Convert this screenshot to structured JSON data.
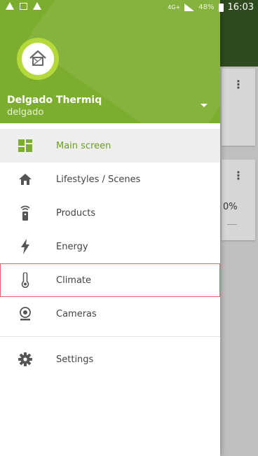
{
  "status_bar": {
    "network": "4G+",
    "battery": "48%",
    "time": "16:03"
  },
  "account": {
    "name": "Delgado Thermiq",
    "login": "delgado"
  },
  "menu": [
    {
      "label": "Main screen",
      "icon": "dashboard-icon",
      "active": true
    },
    {
      "label": "Lifestyles / Scenes",
      "icon": "home-icon"
    },
    {
      "label": "Products",
      "icon": "remote-icon"
    },
    {
      "label": "Energy",
      "icon": "lightning-icon"
    },
    {
      "label": "Climate",
      "icon": "thermometer-icon",
      "highlighted": true
    },
    {
      "label": "Cameras",
      "icon": "camera-icon"
    }
  ],
  "settings": {
    "label": "Settings",
    "icon": "gear-icon"
  },
  "background": {
    "percent": "0%"
  },
  "colors": {
    "brand_green": "#7cad2e",
    "active_green": "#6a9e1f",
    "highlight_red": "#e06070"
  }
}
